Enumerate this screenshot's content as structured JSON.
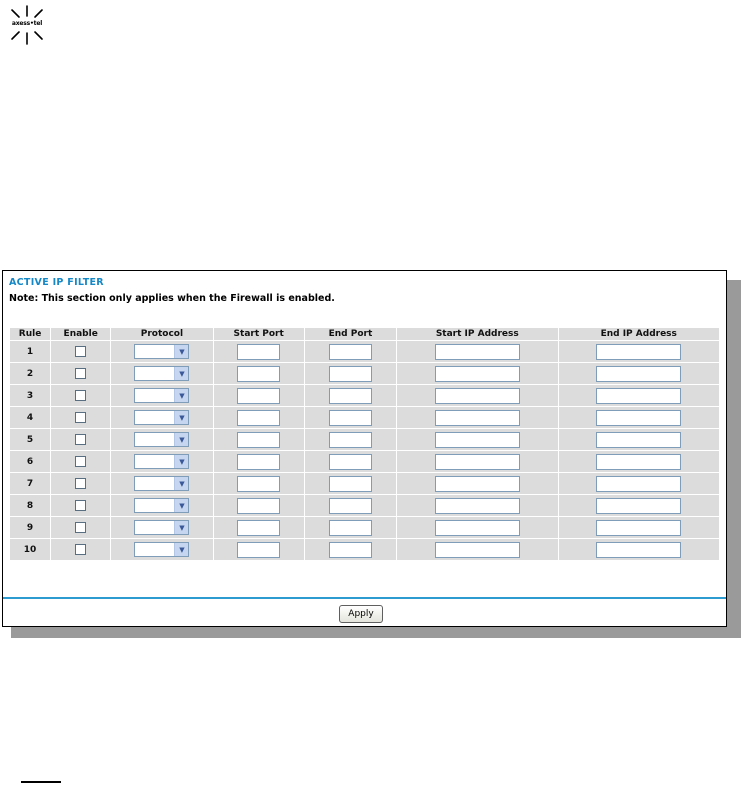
{
  "logo": {
    "text": "axess•tel"
  },
  "panel": {
    "title": "ACTIVE IP FILTER",
    "note": "Note: This section only applies when the Firewall is enabled."
  },
  "table": {
    "headers": [
      "Rule",
      "Enable",
      "Protocol",
      "Start Port",
      "End Port",
      "Start IP Address",
      "End IP Address"
    ],
    "rows": [
      {
        "rule": "1",
        "enabled": false,
        "protocol": "",
        "start_port": "",
        "end_port": "",
        "start_ip": "",
        "end_ip": ""
      },
      {
        "rule": "2",
        "enabled": false,
        "protocol": "",
        "start_port": "",
        "end_port": "",
        "start_ip": "",
        "end_ip": ""
      },
      {
        "rule": "3",
        "enabled": false,
        "protocol": "",
        "start_port": "",
        "end_port": "",
        "start_ip": "",
        "end_ip": ""
      },
      {
        "rule": "4",
        "enabled": false,
        "protocol": "",
        "start_port": "",
        "end_port": "",
        "start_ip": "",
        "end_ip": ""
      },
      {
        "rule": "5",
        "enabled": false,
        "protocol": "",
        "start_port": "",
        "end_port": "",
        "start_ip": "",
        "end_ip": ""
      },
      {
        "rule": "6",
        "enabled": false,
        "protocol": "",
        "start_port": "",
        "end_port": "",
        "start_ip": "",
        "end_ip": ""
      },
      {
        "rule": "7",
        "enabled": false,
        "protocol": "",
        "start_port": "",
        "end_port": "",
        "start_ip": "",
        "end_ip": ""
      },
      {
        "rule": "8",
        "enabled": false,
        "protocol": "",
        "start_port": "",
        "end_port": "",
        "start_ip": "",
        "end_ip": ""
      },
      {
        "rule": "9",
        "enabled": false,
        "protocol": "",
        "start_port": "",
        "end_port": "",
        "start_ip": "",
        "end_ip": ""
      },
      {
        "rule": "10",
        "enabled": false,
        "protocol": "",
        "start_port": "",
        "end_port": "",
        "start_ip": "",
        "end_ip": ""
      }
    ]
  },
  "apply_label": "Apply",
  "colors": {
    "title": "#1588c8",
    "divider": "#2b9bd0",
    "cell_bg": "#dcdcdc"
  }
}
